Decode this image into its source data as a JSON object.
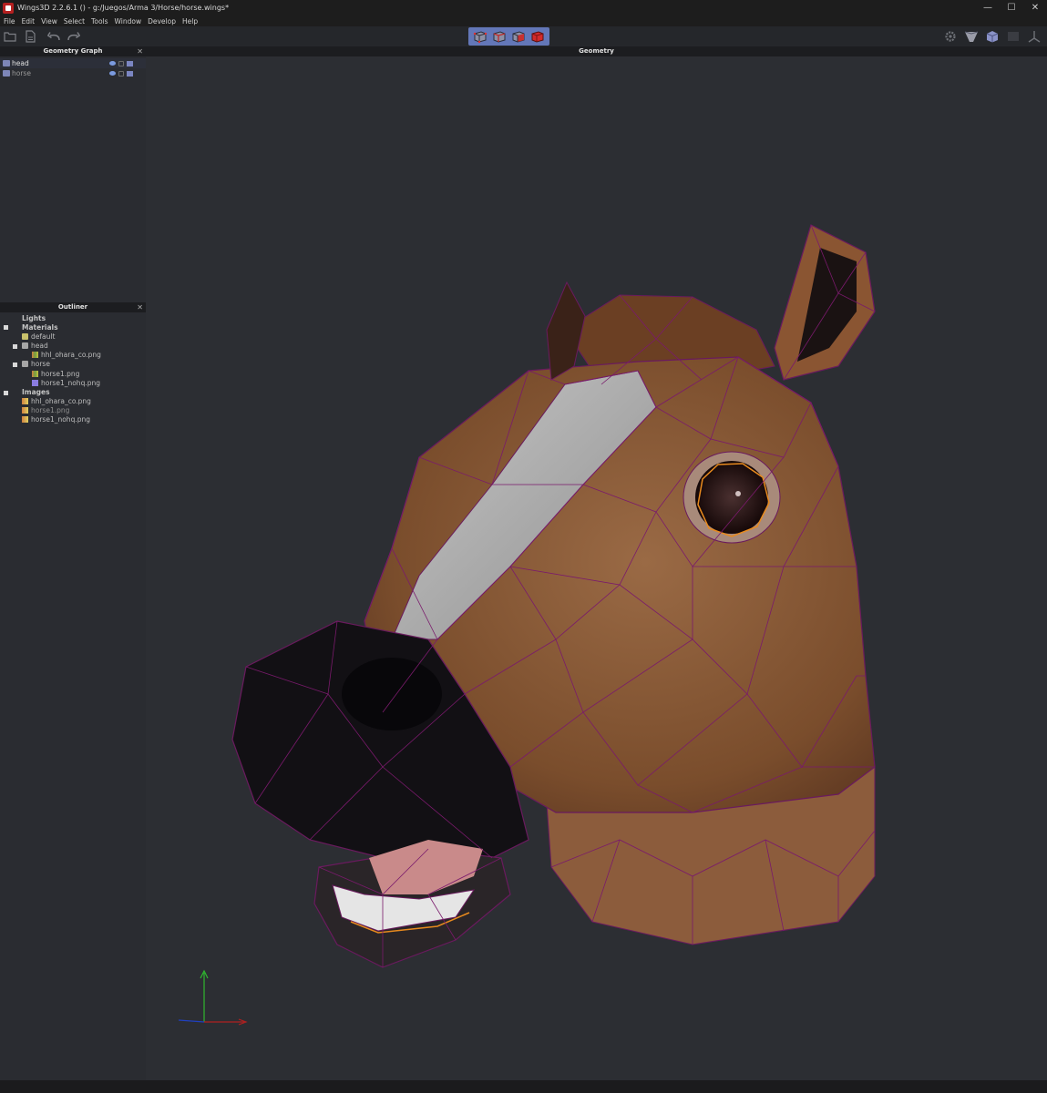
{
  "window": {
    "title": "Wings3D 2.2.6.1 () - g:/Juegos/Arma 3/Horse/horse.wings*",
    "controls": [
      "—",
      "☐",
      "✕"
    ]
  },
  "menu": [
    "File",
    "Edit",
    "View",
    "Select",
    "Tools",
    "Window",
    "Develop",
    "Help"
  ],
  "geometry_graph": {
    "title": "Geometry Graph",
    "objects": [
      {
        "name": "head",
        "selected": true
      },
      {
        "name": "horse",
        "selected": false
      }
    ]
  },
  "outliner": {
    "title": "Outliner",
    "lights_label": "Lights",
    "materials_label": "Materials",
    "materials": [
      {
        "name": "default",
        "color": "#c9c26b"
      },
      {
        "name": "head",
        "color": "#a6a6a6",
        "texture": "hhl_ohara_co.png"
      },
      {
        "name": "horse",
        "color": "#a6a6a6",
        "textures": [
          "horse1.png",
          "horse1_nohq.png"
        ]
      }
    ],
    "images_label": "Images",
    "images": [
      "hhl_ohara_co.png",
      "horse1.png",
      "horse1_nohq.png"
    ]
  },
  "viewport": {
    "title": "Geometry"
  },
  "colors": {
    "accent": "#6377b8",
    "wireframe": "#8a1a7a",
    "selection_edge": "#e88a1e",
    "background": "#2c2e33"
  }
}
